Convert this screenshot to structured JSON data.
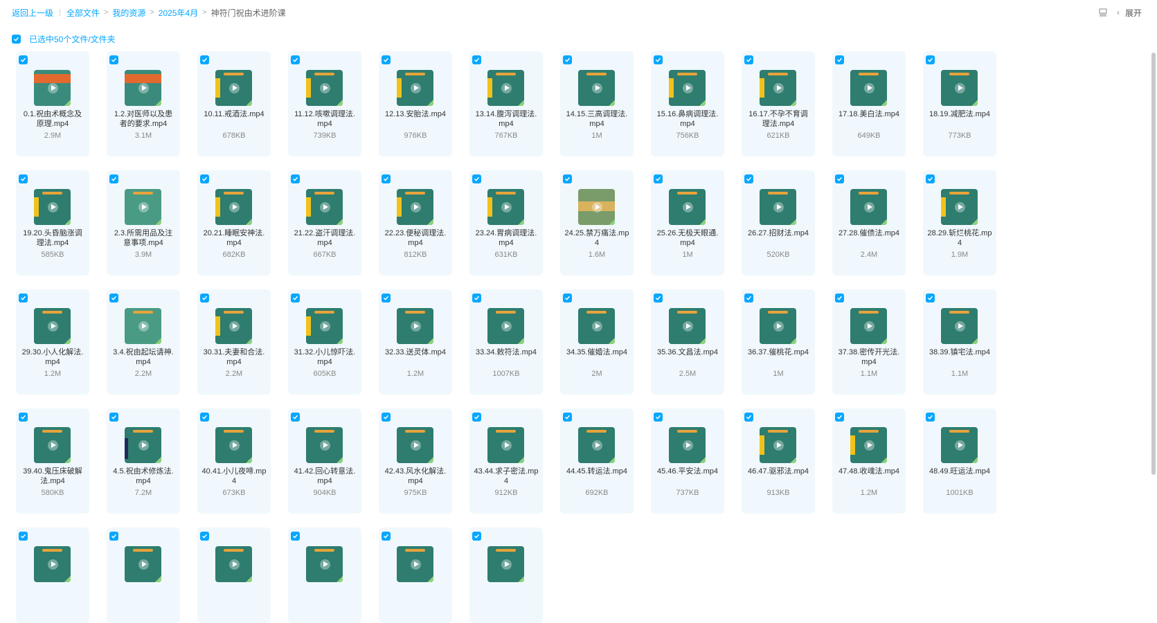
{
  "breadcrumb": {
    "back": "返回上一级",
    "items": [
      "全部文件",
      "我的资源",
      "2025年4月"
    ],
    "current": "神符门祝由术进阶课"
  },
  "toolbar": {
    "expand_label": "展开",
    "collapse_arrow_icon": "chevron-left-icon",
    "list_icon": "list-view-icon"
  },
  "selection": {
    "label": "已选中50个文件/文件夹",
    "checked": true
  },
  "accent_color": "#06a7ff",
  "files": [
    {
      "name": "0.1.祝由术概念及原理.mp4",
      "size": "2.9M",
      "thumb": "orange"
    },
    {
      "name": "1.2.对医师以及患者的要求.mp4",
      "size": "3.1M",
      "thumb": "orange"
    },
    {
      "name": "10.11.戒酒法.mp4",
      "size": "678KB",
      "thumb": "yellow"
    },
    {
      "name": "11.12.咳嗽调理法.mp4",
      "size": "739KB",
      "thumb": "yellow"
    },
    {
      "name": "12.13.安胎法.mp4",
      "size": "976KB",
      "thumb": "yellow"
    },
    {
      "name": "13.14.腹泻调理法.mp4",
      "size": "767KB",
      "thumb": "yellow"
    },
    {
      "name": "14.15.三高调理法.mp4",
      "size": "1M",
      "thumb": "green"
    },
    {
      "name": "15.16.鼻病调理法.mp4",
      "size": "756KB",
      "thumb": "yellow"
    },
    {
      "name": "16.17.不孕不育调理法.mp4",
      "size": "621KB",
      "thumb": "yellow"
    },
    {
      "name": "17.18.美白法.mp4",
      "size": "649KB",
      "thumb": "green"
    },
    {
      "name": "18.19.减肥法.mp4",
      "size": "773KB",
      "thumb": "green"
    },
    {
      "name": "19.20.头昏脑涨调理法.mp4",
      "size": "585KB",
      "thumb": "yellow"
    },
    {
      "name": "2.3.所需用品及注意事项.mp4",
      "size": "3.9M",
      "thumb": "lightgreen"
    },
    {
      "name": "20.21.睡眠安神法.mp4",
      "size": "682KB",
      "thumb": "yellow"
    },
    {
      "name": "21.22.盗汗调理法.mp4",
      "size": "667KB",
      "thumb": "yellow"
    },
    {
      "name": "22.23.便秘调理法.mp4",
      "size": "812KB",
      "thumb": "yellow"
    },
    {
      "name": "23.24.胃病调理法.mp4",
      "size": "631KB",
      "thumb": "yellow"
    },
    {
      "name": "24.25.禁万痛法.mp4",
      "size": "1.6M",
      "thumb": "scene"
    },
    {
      "name": "25.26.无极天眼通.mp4",
      "size": "1M",
      "thumb": "green"
    },
    {
      "name": "26.27.招财法.mp4",
      "size": "520KB",
      "thumb": "green"
    },
    {
      "name": "27.28.催债法.mp4",
      "size": "2.4M",
      "thumb": "green"
    },
    {
      "name": "28.29.斩烂桃花.mp4",
      "size": "1.9M",
      "thumb": "yellow"
    },
    {
      "name": "29.30.小人化解法.mp4",
      "size": "1.2M",
      "thumb": "green"
    },
    {
      "name": "3.4.祝由起坛请神.mp4",
      "size": "2.2M",
      "thumb": "lightgreen"
    },
    {
      "name": "30.31.夫妻和合法.mp4",
      "size": "2.2M",
      "thumb": "yellow"
    },
    {
      "name": "31.32.小儿惊吓法.mp4",
      "size": "605KB",
      "thumb": "yellow"
    },
    {
      "name": "32.33.送灵体.mp4",
      "size": "1.2M",
      "thumb": "green"
    },
    {
      "name": "33.34.敕符法.mp4",
      "size": "1007KB",
      "thumb": "green"
    },
    {
      "name": "34.35.催婚法.mp4",
      "size": "2M",
      "thumb": "green"
    },
    {
      "name": "35.36.文昌法.mp4",
      "size": "2.5M",
      "thumb": "green"
    },
    {
      "name": "36.37.催桃花.mp4",
      "size": "1M",
      "thumb": "green"
    },
    {
      "name": "37.38.密传开光法.mp4",
      "size": "1.1M",
      "thumb": "green"
    },
    {
      "name": "38.39.镇宅法.mp4",
      "size": "1.1M",
      "thumb": "green"
    },
    {
      "name": "39.40.鬼压床破解法.mp4",
      "size": "580KB",
      "thumb": "green"
    },
    {
      "name": "4.5.祝由术修炼法.mp4",
      "size": "7.2M",
      "thumb": "navy"
    },
    {
      "name": "40.41.小儿夜啼.mp4",
      "size": "673KB",
      "thumb": "green"
    },
    {
      "name": "41.42.回心转意法.mp4",
      "size": "904KB",
      "thumb": "green"
    },
    {
      "name": "42.43.风水化解法.mp4",
      "size": "975KB",
      "thumb": "green"
    },
    {
      "name": "43.44.求子密法.mp4",
      "size": "912KB",
      "thumb": "green"
    },
    {
      "name": "44.45.转运法.mp4",
      "size": "692KB",
      "thumb": "green"
    },
    {
      "name": "45.46.平安法.mp4",
      "size": "737KB",
      "thumb": "green"
    },
    {
      "name": "46.47.驱邪法.mp4",
      "size": "913KB",
      "thumb": "yellow"
    },
    {
      "name": "47.48.收魂法.mp4",
      "size": "1.2M",
      "thumb": "yellow"
    },
    {
      "name": "48.49.旺运法.mp4",
      "size": "1001KB",
      "thumb": "green"
    },
    {
      "name": "",
      "size": "",
      "thumb": "green"
    },
    {
      "name": "",
      "size": "",
      "thumb": "green"
    },
    {
      "name": "",
      "size": "",
      "thumb": "green"
    },
    {
      "name": "",
      "size": "",
      "thumb": "green"
    },
    {
      "name": "",
      "size": "",
      "thumb": "green"
    },
    {
      "name": "",
      "size": "",
      "thumb": "green"
    }
  ]
}
